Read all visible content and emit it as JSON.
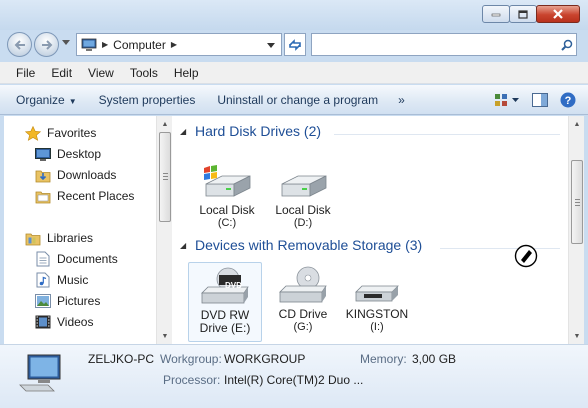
{
  "window": {
    "controls": {
      "minimize_icon": "minimize-icon",
      "maximize_icon": "maximize-icon",
      "close_icon": "close-icon"
    }
  },
  "address_bar": {
    "breadcrumb": "Computer",
    "search_placeholder": ""
  },
  "menu": [
    "File",
    "Edit",
    "View",
    "Tools",
    "Help"
  ],
  "toolbar": {
    "organize": "Organize",
    "system_properties": "System properties",
    "uninstall": "Uninstall or change a program",
    "more": "»"
  },
  "nav": {
    "favorites": "Favorites",
    "desktop": "Desktop",
    "downloads": "Downloads",
    "recent": "Recent Places",
    "libraries": "Libraries",
    "documents": "Documents",
    "music": "Music",
    "pictures": "Pictures",
    "videos": "Videos"
  },
  "groups": {
    "hard_disks": {
      "title": "Hard Disk Drives (2)",
      "drives": [
        {
          "name": "Local Disk",
          "letter": "(C:)"
        },
        {
          "name": "Local Disk",
          "letter": "(D:)"
        }
      ]
    },
    "removable": {
      "title": "Devices with Removable Storage (3)",
      "drives": [
        {
          "name": "DVD RW",
          "letter": "Drive (E:)",
          "badge": "DVD"
        },
        {
          "name": "CD Drive",
          "letter": "(G:)"
        },
        {
          "name": "KINGSTON",
          "letter": "(I:)"
        }
      ]
    }
  },
  "details": {
    "computer_name": "ZELJKO-PC",
    "workgroup_label": "Workgroup:",
    "workgroup_value": "WORKGROUP",
    "memory_label": "Memory:",
    "memory_value": "3,00 GB",
    "processor_label": "Processor:",
    "processor_value": "Intel(R) Core(TM)2 Duo ..."
  },
  "colors": {
    "group_title": "#1e4e96",
    "toolbar_text": "#1e395b",
    "close_button": "#c9442e"
  }
}
